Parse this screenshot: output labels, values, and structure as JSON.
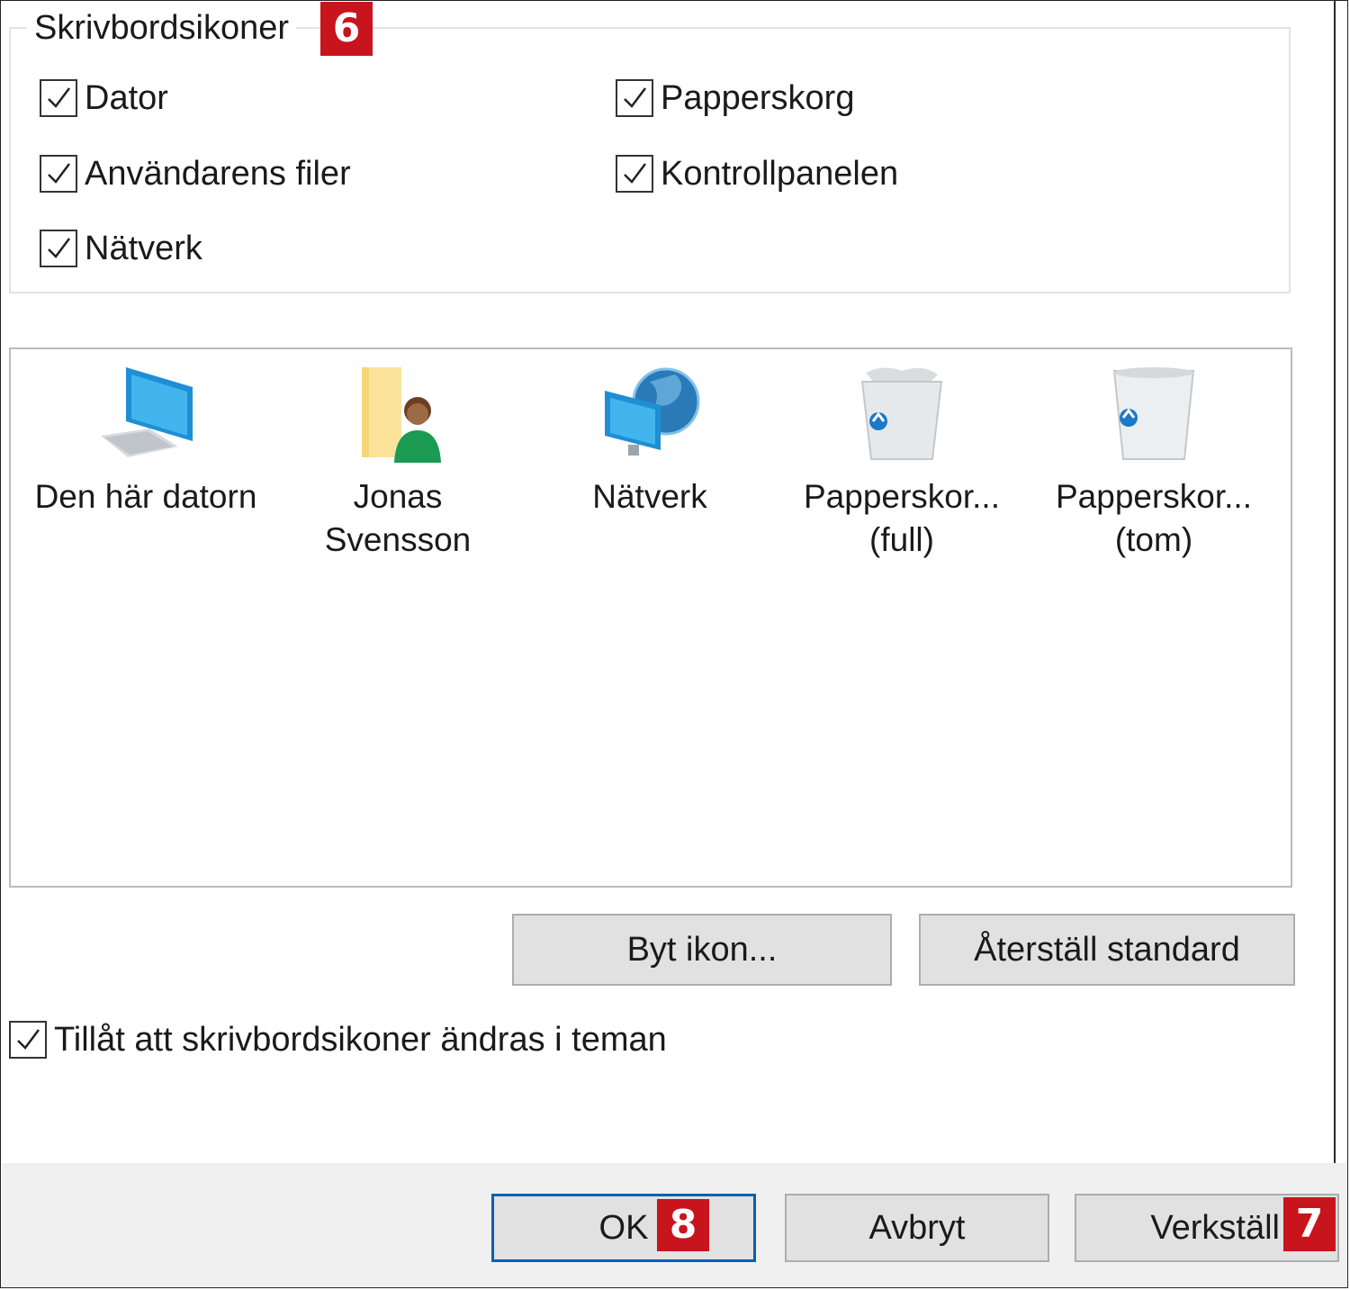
{
  "group": {
    "title": "Skrivbordsikoner",
    "badge": "6",
    "checkboxes": [
      {
        "label": "Dator",
        "checked": true
      },
      {
        "label": "Papperskorg",
        "checked": true
      },
      {
        "label": "Användarens filer",
        "checked": true
      },
      {
        "label": "Kontrollpanelen",
        "checked": true
      },
      {
        "label": "Nätverk",
        "checked": true
      }
    ]
  },
  "icons": [
    {
      "line1": "Den här datorn",
      "line2": "",
      "icon": "computer-icon"
    },
    {
      "line1": "Jonas",
      "line2": "Svensson",
      "icon": "user-folder-icon"
    },
    {
      "line1": "Nätverk",
      "line2": "",
      "icon": "network-icon"
    },
    {
      "line1": "Papperskor...",
      "line2": "(full)",
      "icon": "recycle-bin-full-icon"
    },
    {
      "line1": "Papperskor...",
      "line2": "(tom)",
      "icon": "recycle-bin-empty-icon"
    }
  ],
  "buttons": {
    "change_icon": "Byt ikon...",
    "restore_default": "Återställ standard"
  },
  "theme_checkbox": {
    "label": "Tillåt att skrivbordsikoner ändras i teman",
    "checked": true
  },
  "footer": {
    "ok": "OK",
    "ok_badge": "8",
    "cancel": "Avbryt",
    "apply": "Verkställ",
    "apply_badge": "7"
  },
  "colors": {
    "badge": "#c8141c",
    "focus_border": "#0a5fb4"
  }
}
